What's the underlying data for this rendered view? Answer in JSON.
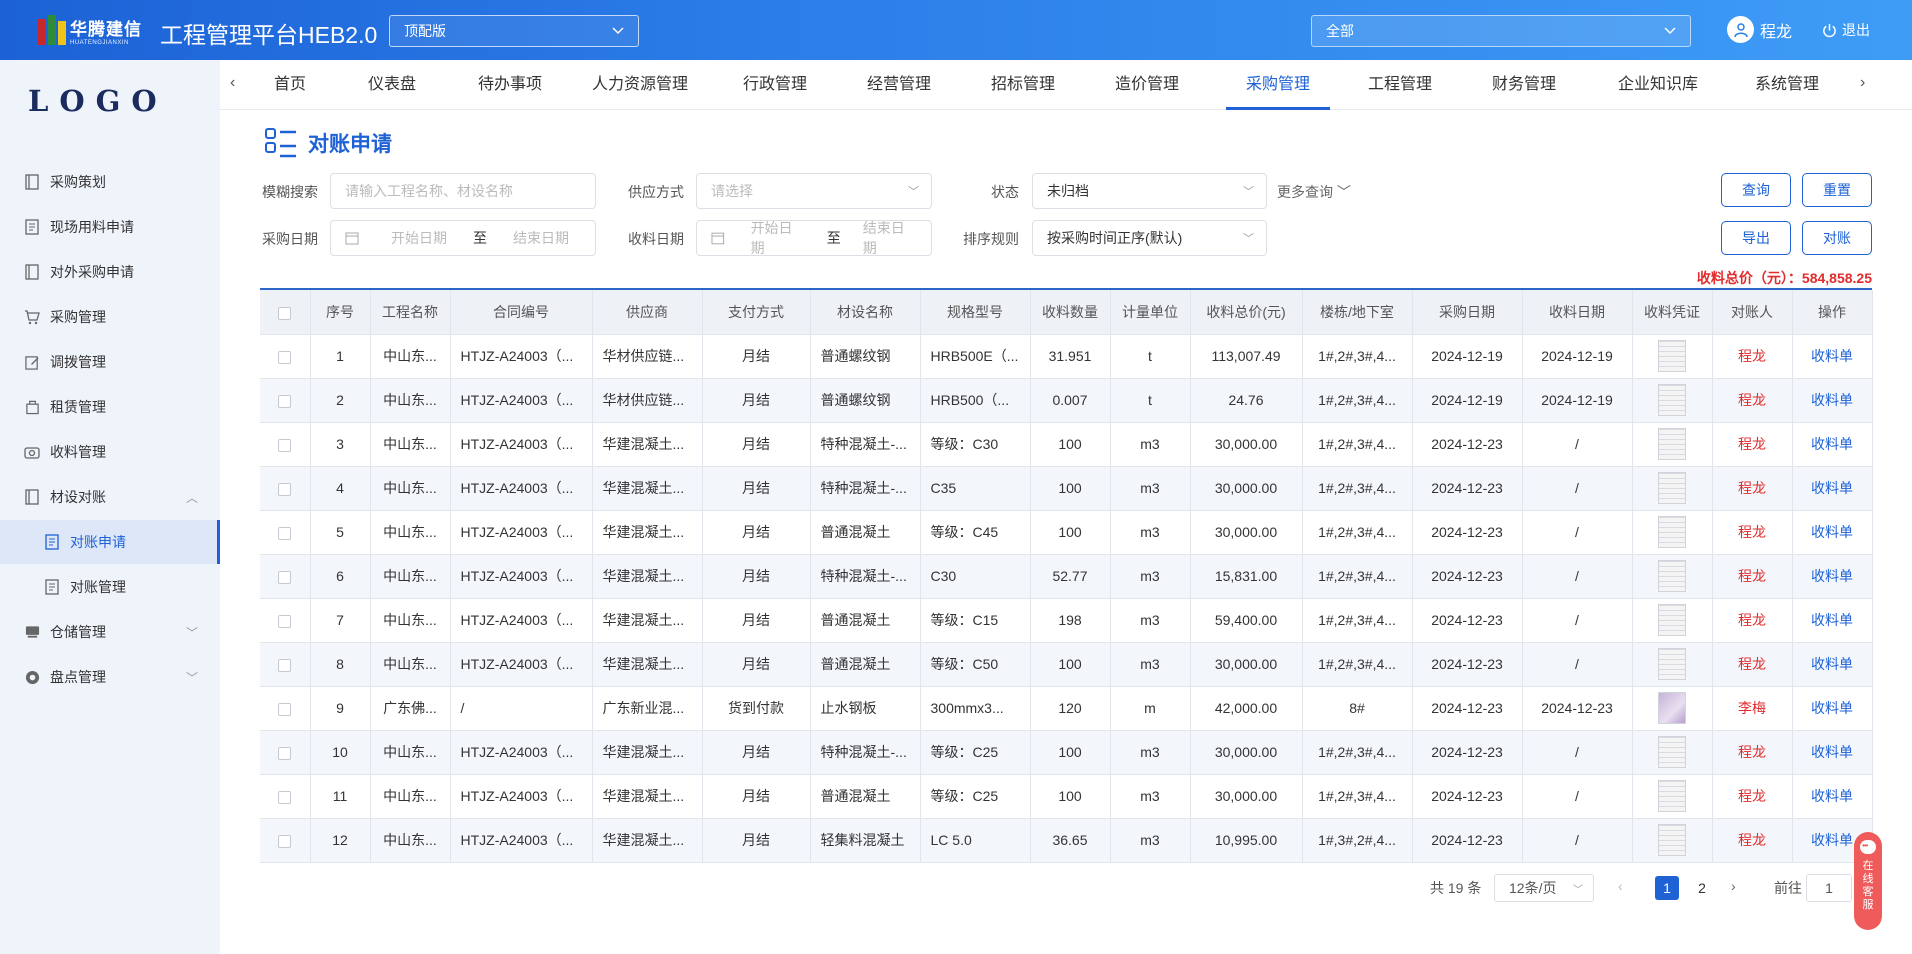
{
  "header": {
    "logo_cn": "华腾建信",
    "logo_en": "HUATENGJIANXIN",
    "app_title": "工程管理平台HEB2.0",
    "edition": "顶配版",
    "scope": "全部",
    "user_name": "程龙",
    "logout_label": "退出"
  },
  "sidebar": {
    "logo": "LOGO",
    "items": [
      {
        "label": "采购策划",
        "icon": "plan-icon"
      },
      {
        "label": "现场用料申请",
        "icon": "doc-icon"
      },
      {
        "label": "对外采购申请",
        "icon": "doc-icon"
      },
      {
        "label": "采购管理",
        "icon": "cart-icon"
      },
      {
        "label": "调拨管理",
        "icon": "edit-icon"
      },
      {
        "label": "租赁管理",
        "icon": "lease-icon"
      },
      {
        "label": "收料管理",
        "icon": "receive-icon"
      },
      {
        "label": "材设对账",
        "icon": "reconcile-icon"
      },
      {
        "label": "对账申请",
        "icon": "doc-icon"
      },
      {
        "label": "对账管理",
        "icon": "doc-icon"
      },
      {
        "label": "仓储管理",
        "icon": "warehouse-icon"
      },
      {
        "label": "盘点管理",
        "icon": "inventory-icon"
      }
    ]
  },
  "nav": {
    "tabs": [
      "首页",
      "仪表盘",
      "待办事项",
      "人力资源管理",
      "行政管理",
      "经营管理",
      "招标管理",
      "造价管理",
      "采购管理",
      "工程管理",
      "财务管理",
      "企业知识库",
      "系统管理"
    ],
    "active": "采购管理"
  },
  "page": {
    "title": "对账申请"
  },
  "filters": {
    "fuzzy_label": "模糊搜索",
    "fuzzy_placeholder": "请输入工程名称、材设名称",
    "supply_label": "供应方式",
    "supply_placeholder": "请选择",
    "status_label": "状态",
    "status_value": "未归档",
    "more_label": "更多查询",
    "purchase_date_label": "采购日期",
    "start_placeholder": "开始日期",
    "range_sep": "至",
    "end_placeholder": "结束日期",
    "receive_date_label": "收料日期",
    "sort_label": "排序规则",
    "sort_value": "按采购时间正序(默认)"
  },
  "buttons": {
    "query": "查询",
    "reset": "重置",
    "export": "导出",
    "reconcile": "对账"
  },
  "total": {
    "label": "收料总价（元）：",
    "value": "584,858.25"
  },
  "table": {
    "columns": [
      "",
      "序号",
      "工程名称",
      "合同编号",
      "供应商",
      "支付方式",
      "材设名称",
      "规格型号",
      "收料数量",
      "计量单位",
      "收料总价(元)",
      "楼栋/地下室",
      "采购日期",
      "收料日期",
      "收料凭证",
      "对账人",
      "操作"
    ],
    "rows": [
      {
        "no": "1",
        "project": "中山东...",
        "contract": "HTJZ-A24003（...",
        "supplier": "华材供应链...",
        "pay": "月结",
        "material": "普通螺纹钢",
        "spec": "HRB500E（...",
        "qty": "31.951",
        "unit": "t",
        "total": "113,007.49",
        "building": "1#,2#,3#,4...",
        "purchase_date": "2024-12-19",
        "receive_date": "2024-12-19",
        "voucher": "grey",
        "reconciler": "程龙",
        "action": "收料单"
      },
      {
        "no": "2",
        "project": "中山东...",
        "contract": "HTJZ-A24003（...",
        "supplier": "华材供应链...",
        "pay": "月结",
        "material": "普通螺纹钢",
        "spec": "HRB500（...",
        "qty": "0.007",
        "unit": "t",
        "total": "24.76",
        "building": "1#,2#,3#,4...",
        "purchase_date": "2024-12-19",
        "receive_date": "2024-12-19",
        "voucher": "grey",
        "reconciler": "程龙",
        "action": "收料单"
      },
      {
        "no": "3",
        "project": "中山东...",
        "contract": "HTJZ-A24003（...",
        "supplier": "华建混凝土...",
        "pay": "月结",
        "material": "特种混凝土-...",
        "spec": "等级：C30",
        "qty": "100",
        "unit": "m3",
        "total": "30,000.00",
        "building": "1#,2#,3#,4...",
        "purchase_date": "2024-12-23",
        "receive_date": "/",
        "voucher": "grey",
        "reconciler": "程龙",
        "action": "收料单"
      },
      {
        "no": "4",
        "project": "中山东...",
        "contract": "HTJZ-A24003（...",
        "supplier": "华建混凝土...",
        "pay": "月结",
        "material": "特种混凝土-...",
        "spec": "C35",
        "qty": "100",
        "unit": "m3",
        "total": "30,000.00",
        "building": "1#,2#,3#,4...",
        "purchase_date": "2024-12-23",
        "receive_date": "/",
        "voucher": "grey",
        "reconciler": "程龙",
        "action": "收料单"
      },
      {
        "no": "5",
        "project": "中山东...",
        "contract": "HTJZ-A24003（...",
        "supplier": "华建混凝土...",
        "pay": "月结",
        "material": "普通混凝土",
        "spec": "等级：C45",
        "qty": "100",
        "unit": "m3",
        "total": "30,000.00",
        "building": "1#,2#,3#,4...",
        "purchase_date": "2024-12-23",
        "receive_date": "/",
        "voucher": "grey",
        "reconciler": "程龙",
        "action": "收料单"
      },
      {
        "no": "6",
        "project": "中山东...",
        "contract": "HTJZ-A24003（...",
        "supplier": "华建混凝土...",
        "pay": "月结",
        "material": "特种混凝土-...",
        "spec": "C30",
        "qty": "52.77",
        "unit": "m3",
        "total": "15,831.00",
        "building": "1#,2#,3#,4...",
        "purchase_date": "2024-12-23",
        "receive_date": "/",
        "voucher": "grey",
        "reconciler": "程龙",
        "action": "收料单"
      },
      {
        "no": "7",
        "project": "中山东...",
        "contract": "HTJZ-A24003（...",
        "supplier": "华建混凝土...",
        "pay": "月结",
        "material": "普通混凝土",
        "spec": "等级：C15",
        "qty": "198",
        "unit": "m3",
        "total": "59,400.00",
        "building": "1#,2#,3#,4...",
        "purchase_date": "2024-12-23",
        "receive_date": "/",
        "voucher": "grey",
        "reconciler": "程龙",
        "action": "收料单"
      },
      {
        "no": "8",
        "project": "中山东...",
        "contract": "HTJZ-A24003（...",
        "supplier": "华建混凝土...",
        "pay": "月结",
        "material": "普通混凝土",
        "spec": "等级：C50",
        "qty": "100",
        "unit": "m3",
        "total": "30,000.00",
        "building": "1#,2#,3#,4...",
        "purchase_date": "2024-12-23",
        "receive_date": "/",
        "voucher": "grey",
        "reconciler": "程龙",
        "action": "收料单"
      },
      {
        "no": "9",
        "project": "广东佛...",
        "contract": "/",
        "supplier": "广东新业混...",
        "pay": "货到付款",
        "material": "止水钢板",
        "spec": "300mmx3...",
        "qty": "120",
        "unit": "m",
        "total": "42,000.00",
        "building": "8#",
        "purchase_date": "2024-12-23",
        "receive_date": "2024-12-23",
        "voucher": "purple",
        "reconciler": "李梅",
        "action": "收料单"
      },
      {
        "no": "10",
        "project": "中山东...",
        "contract": "HTJZ-A24003（...",
        "supplier": "华建混凝土...",
        "pay": "月结",
        "material": "特种混凝土-...",
        "spec": "等级：C25",
        "qty": "100",
        "unit": "m3",
        "total": "30,000.00",
        "building": "1#,2#,3#,4...",
        "purchase_date": "2024-12-23",
        "receive_date": "/",
        "voucher": "grey",
        "reconciler": "程龙",
        "action": "收料单"
      },
      {
        "no": "11",
        "project": "中山东...",
        "contract": "HTJZ-A24003（...",
        "supplier": "华建混凝土...",
        "pay": "月结",
        "material": "普通混凝土",
        "spec": "等级：C25",
        "qty": "100",
        "unit": "m3",
        "total": "30,000.00",
        "building": "1#,2#,3#,4...",
        "purchase_date": "2024-12-23",
        "receive_date": "/",
        "voucher": "grey",
        "reconciler": "程龙",
        "action": "收料单"
      },
      {
        "no": "12",
        "project": "中山东...",
        "contract": "HTJZ-A24003（...",
        "supplier": "华建混凝土...",
        "pay": "月结",
        "material": "轻集料混凝土",
        "spec": "LC 5.0",
        "qty": "36.65",
        "unit": "m3",
        "total": "10,995.00",
        "building": "1#,3#,2#,4...",
        "purchase_date": "2024-12-23",
        "receive_date": "/",
        "voucher": "grey",
        "reconciler": "程龙",
        "action": "收料单"
      }
    ]
  },
  "pagination": {
    "total_text": "共 19 条",
    "page_size": "12条/页",
    "pages": [
      "1",
      "2"
    ],
    "current": "1",
    "goto_label": "前往",
    "goto_value": "1"
  },
  "service": {
    "label": "在线客服"
  },
  "colors": {
    "primary": "#1e62d6",
    "danger": "#e22c2c",
    "header_gradient_start": "#1c62d6",
    "header_gradient_end": "#3e9cf6"
  }
}
